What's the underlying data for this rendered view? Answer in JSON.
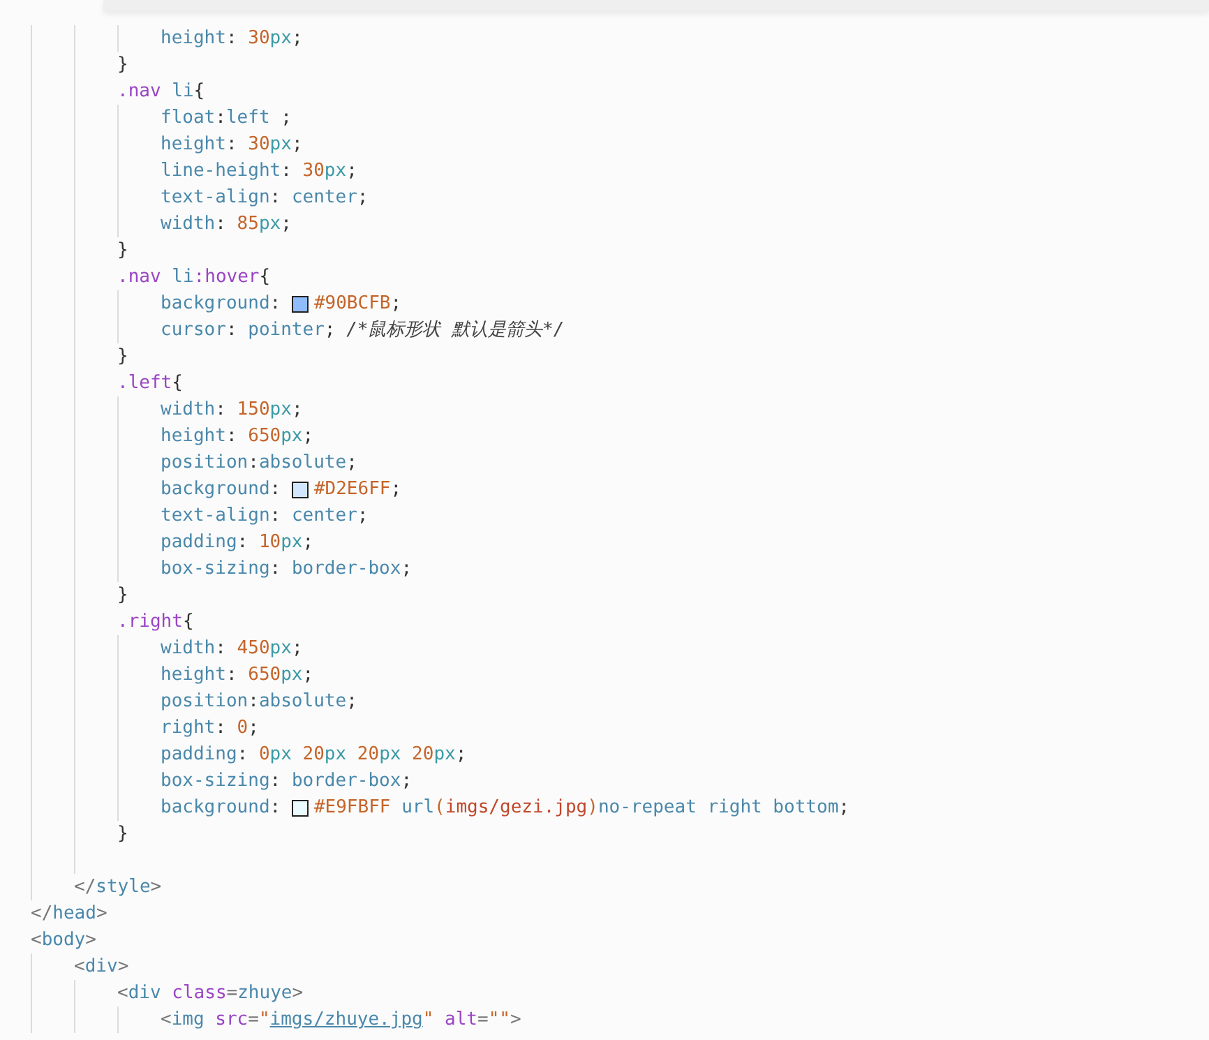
{
  "editor": {
    "lines": [
      {
        "kind": "wrap",
        "children": [
          {
            "kind": "wrap",
            "children": [
              {
                "kind": "wrap",
                "children": [
                  {
                    "kind": "code",
                    "tokens": [
                      {
                        "kind": "prop",
                        "text": "height"
                      },
                      {
                        "kind": "punct",
                        "text": ": "
                      },
                      {
                        "kind": "num",
                        "text": "30"
                      },
                      {
                        "kind": "unit",
                        "text": "px"
                      },
                      {
                        "kind": "punct",
                        "text": ";"
                      }
                    ]
                  }
                ]
              },
              {
                "kind": "code",
                "tokens": [
                  {
                    "kind": "punct",
                    "text": "}"
                  }
                ]
              },
              {
                "kind": "code",
                "tokens": [
                  {
                    "kind": "cls",
                    "text": ".nav "
                  },
                  {
                    "kind": "tagsel",
                    "text": "li"
                  },
                  {
                    "kind": "punct",
                    "text": "{"
                  }
                ],
                "children": [
                  {
                    "kind": "code",
                    "tokens": [
                      {
                        "kind": "prop",
                        "text": "float"
                      },
                      {
                        "kind": "punct",
                        "text": ":"
                      },
                      {
                        "kind": "kw",
                        "text": "left"
                      },
                      {
                        "kind": "punct",
                        "text": " ;"
                      }
                    ]
                  },
                  {
                    "kind": "code",
                    "tokens": [
                      {
                        "kind": "prop",
                        "text": "height"
                      },
                      {
                        "kind": "punct",
                        "text": ": "
                      },
                      {
                        "kind": "num",
                        "text": "30"
                      },
                      {
                        "kind": "unit",
                        "text": "px"
                      },
                      {
                        "kind": "punct",
                        "text": ";"
                      }
                    ]
                  },
                  {
                    "kind": "code",
                    "tokens": [
                      {
                        "kind": "prop",
                        "text": "line-height"
                      },
                      {
                        "kind": "punct",
                        "text": ": "
                      },
                      {
                        "kind": "num",
                        "text": "30"
                      },
                      {
                        "kind": "unit",
                        "text": "px"
                      },
                      {
                        "kind": "punct",
                        "text": ";"
                      }
                    ]
                  },
                  {
                    "kind": "code",
                    "tokens": [
                      {
                        "kind": "prop",
                        "text": "text-align"
                      },
                      {
                        "kind": "punct",
                        "text": ": "
                      },
                      {
                        "kind": "kw",
                        "text": "center"
                      },
                      {
                        "kind": "punct",
                        "text": ";"
                      }
                    ]
                  },
                  {
                    "kind": "code",
                    "tokens": [
                      {
                        "kind": "prop",
                        "text": "width"
                      },
                      {
                        "kind": "punct",
                        "text": ": "
                      },
                      {
                        "kind": "num",
                        "text": "85"
                      },
                      {
                        "kind": "unit",
                        "text": "px"
                      },
                      {
                        "kind": "punct",
                        "text": ";"
                      }
                    ]
                  }
                ]
              },
              {
                "kind": "code",
                "tokens": [
                  {
                    "kind": "punct",
                    "text": "}"
                  }
                ]
              },
              {
                "kind": "code",
                "tokens": [
                  {
                    "kind": "cls",
                    "text": ".nav "
                  },
                  {
                    "kind": "tagsel",
                    "text": "li"
                  },
                  {
                    "kind": "cls",
                    "text": ":hover"
                  },
                  {
                    "kind": "punct",
                    "text": "{"
                  }
                ],
                "children": [
                  {
                    "kind": "code",
                    "tokens": [
                      {
                        "kind": "prop",
                        "text": "background"
                      },
                      {
                        "kind": "punct",
                        "text": ": "
                      },
                      {
                        "kind": "swatch",
                        "color": "#90bcfb"
                      },
                      {
                        "kind": "num",
                        "text": "#90BCFB"
                      },
                      {
                        "kind": "punct",
                        "text": ";"
                      }
                    ]
                  },
                  {
                    "kind": "code",
                    "tokens": [
                      {
                        "kind": "prop",
                        "text": "cursor"
                      },
                      {
                        "kind": "punct",
                        "text": ": "
                      },
                      {
                        "kind": "kw",
                        "text": "pointer"
                      },
                      {
                        "kind": "punct",
                        "text": "; "
                      },
                      {
                        "kind": "comment",
                        "text": "/*鼠标形状 默认是箭头*/"
                      }
                    ]
                  }
                ]
              },
              {
                "kind": "code",
                "tokens": [
                  {
                    "kind": "punct",
                    "text": "}"
                  }
                ]
              },
              {
                "kind": "code",
                "tokens": [
                  {
                    "kind": "cls",
                    "text": ".left"
                  },
                  {
                    "kind": "punct",
                    "text": "{"
                  }
                ],
                "children": [
                  {
                    "kind": "code",
                    "tokens": [
                      {
                        "kind": "prop",
                        "text": "width"
                      },
                      {
                        "kind": "punct",
                        "text": ": "
                      },
                      {
                        "kind": "num",
                        "text": "150"
                      },
                      {
                        "kind": "unit",
                        "text": "px"
                      },
                      {
                        "kind": "punct",
                        "text": ";"
                      }
                    ]
                  },
                  {
                    "kind": "code",
                    "tokens": [
                      {
                        "kind": "prop",
                        "text": "height"
                      },
                      {
                        "kind": "punct",
                        "text": ": "
                      },
                      {
                        "kind": "num",
                        "text": "650"
                      },
                      {
                        "kind": "unit",
                        "text": "px"
                      },
                      {
                        "kind": "punct",
                        "text": ";"
                      }
                    ]
                  },
                  {
                    "kind": "code",
                    "tokens": [
                      {
                        "kind": "prop",
                        "text": "position"
                      },
                      {
                        "kind": "punct",
                        "text": ":"
                      },
                      {
                        "kind": "kw",
                        "text": "absolute"
                      },
                      {
                        "kind": "punct",
                        "text": ";"
                      }
                    ]
                  },
                  {
                    "kind": "code",
                    "tokens": [
                      {
                        "kind": "prop",
                        "text": "background"
                      },
                      {
                        "kind": "punct",
                        "text": ": "
                      },
                      {
                        "kind": "swatch",
                        "color": "#d2e6ff"
                      },
                      {
                        "kind": "num",
                        "text": "#D2E6FF"
                      },
                      {
                        "kind": "punct",
                        "text": ";"
                      }
                    ]
                  },
                  {
                    "kind": "code",
                    "tokens": [
                      {
                        "kind": "prop",
                        "text": "text-align"
                      },
                      {
                        "kind": "punct",
                        "text": ": "
                      },
                      {
                        "kind": "kw",
                        "text": "center"
                      },
                      {
                        "kind": "punct",
                        "text": ";"
                      }
                    ]
                  },
                  {
                    "kind": "code",
                    "tokens": [
                      {
                        "kind": "prop",
                        "text": "padding"
                      },
                      {
                        "kind": "punct",
                        "text": ": "
                      },
                      {
                        "kind": "num",
                        "text": "10"
                      },
                      {
                        "kind": "unit",
                        "text": "px"
                      },
                      {
                        "kind": "punct",
                        "text": ";"
                      }
                    ]
                  },
                  {
                    "kind": "code",
                    "tokens": [
                      {
                        "kind": "prop",
                        "text": "box-sizing"
                      },
                      {
                        "kind": "punct",
                        "text": ": "
                      },
                      {
                        "kind": "kw",
                        "text": "border-box"
                      },
                      {
                        "kind": "punct",
                        "text": ";"
                      }
                    ]
                  }
                ]
              },
              {
                "kind": "code",
                "tokens": [
                  {
                    "kind": "punct",
                    "text": "}"
                  }
                ]
              },
              {
                "kind": "code",
                "tokens": [
                  {
                    "kind": "cls",
                    "text": ".right"
                  },
                  {
                    "kind": "punct",
                    "text": "{"
                  }
                ],
                "children": [
                  {
                    "kind": "code",
                    "tokens": [
                      {
                        "kind": "prop",
                        "text": "width"
                      },
                      {
                        "kind": "punct",
                        "text": ": "
                      },
                      {
                        "kind": "num",
                        "text": "450"
                      },
                      {
                        "kind": "unit",
                        "text": "px"
                      },
                      {
                        "kind": "punct",
                        "text": ";"
                      }
                    ]
                  },
                  {
                    "kind": "code",
                    "tokens": [
                      {
                        "kind": "prop",
                        "text": "height"
                      },
                      {
                        "kind": "punct",
                        "text": ": "
                      },
                      {
                        "kind": "num",
                        "text": "650"
                      },
                      {
                        "kind": "unit",
                        "text": "px"
                      },
                      {
                        "kind": "punct",
                        "text": ";"
                      }
                    ]
                  },
                  {
                    "kind": "code",
                    "tokens": [
                      {
                        "kind": "prop",
                        "text": "position"
                      },
                      {
                        "kind": "punct",
                        "text": ":"
                      },
                      {
                        "kind": "kw",
                        "text": "absolute"
                      },
                      {
                        "kind": "punct",
                        "text": ";"
                      }
                    ]
                  },
                  {
                    "kind": "code",
                    "tokens": [
                      {
                        "kind": "prop",
                        "text": "right"
                      },
                      {
                        "kind": "punct",
                        "text": ": "
                      },
                      {
                        "kind": "num",
                        "text": "0"
                      },
                      {
                        "kind": "punct",
                        "text": ";"
                      }
                    ]
                  },
                  {
                    "kind": "code",
                    "tokens": [
                      {
                        "kind": "prop",
                        "text": "padding"
                      },
                      {
                        "kind": "punct",
                        "text": ": "
                      },
                      {
                        "kind": "num",
                        "text": "0"
                      },
                      {
                        "kind": "unit",
                        "text": "px "
                      },
                      {
                        "kind": "num",
                        "text": "20"
                      },
                      {
                        "kind": "unit",
                        "text": "px "
                      },
                      {
                        "kind": "num",
                        "text": "20"
                      },
                      {
                        "kind": "unit",
                        "text": "px "
                      },
                      {
                        "kind": "num",
                        "text": "20"
                      },
                      {
                        "kind": "unit",
                        "text": "px"
                      },
                      {
                        "kind": "punct",
                        "text": ";"
                      }
                    ]
                  },
                  {
                    "kind": "code",
                    "tokens": [
                      {
                        "kind": "prop",
                        "text": "box-sizing"
                      },
                      {
                        "kind": "punct",
                        "text": ": "
                      },
                      {
                        "kind": "kw",
                        "text": "border-box"
                      },
                      {
                        "kind": "punct",
                        "text": ";"
                      }
                    ]
                  },
                  {
                    "kind": "code",
                    "tokens": [
                      {
                        "kind": "prop",
                        "text": "background"
                      },
                      {
                        "kind": "punct",
                        "text": ": "
                      },
                      {
                        "kind": "swatch",
                        "color": "#e9fbff"
                      },
                      {
                        "kind": "num",
                        "text": "#E9FBFF "
                      },
                      {
                        "kind": "kw",
                        "text": "url"
                      },
                      {
                        "kind": "num",
                        "text": "("
                      },
                      {
                        "kind": "path",
                        "text": "imgs/gezi.jpg"
                      },
                      {
                        "kind": "num",
                        "text": ")"
                      },
                      {
                        "kind": "kw",
                        "text": "no-repeat right bottom"
                      },
                      {
                        "kind": "punct",
                        "text": ";"
                      }
                    ]
                  }
                ]
              },
              {
                "kind": "code",
                "tokens": [
                  {
                    "kind": "punct",
                    "text": "}"
                  }
                ]
              },
              {
                "kind": "blank"
              }
            ]
          },
          {
            "kind": "code",
            "tokens": [
              {
                "kind": "bracket",
                "text": "</"
              },
              {
                "kind": "tag",
                "text": "style"
              },
              {
                "kind": "bracket",
                "text": ">"
              }
            ]
          }
        ]
      },
      {
        "kind": "code",
        "tokens": [
          {
            "kind": "bracket",
            "text": "</"
          },
          {
            "kind": "tag",
            "text": "head"
          },
          {
            "kind": "bracket",
            "text": ">"
          }
        ]
      },
      {
        "kind": "code",
        "tokens": [
          {
            "kind": "bracket",
            "text": "<"
          },
          {
            "kind": "tag",
            "text": "body"
          },
          {
            "kind": "bracket",
            "text": ">"
          }
        ],
        "children": [
          {
            "kind": "code",
            "tokens": [
              {
                "kind": "bracket",
                "text": "<"
              },
              {
                "kind": "tag",
                "text": "div"
              },
              {
                "kind": "bracket",
                "text": ">"
              }
            ],
            "children": [
              {
                "kind": "code",
                "tokens": [
                  {
                    "kind": "bracket",
                    "text": "<"
                  },
                  {
                    "kind": "tag",
                    "text": "div "
                  },
                  {
                    "kind": "attr",
                    "text": "class"
                  },
                  {
                    "kind": "bracket",
                    "text": "="
                  },
                  {
                    "kind": "tag",
                    "text": "zhuye"
                  },
                  {
                    "kind": "bracket",
                    "text": ">"
                  }
                ],
                "children": [
                  {
                    "kind": "code",
                    "tokens": [
                      {
                        "kind": "bracket",
                        "text": "<"
                      },
                      {
                        "kind": "tag",
                        "text": "img "
                      },
                      {
                        "kind": "attr",
                        "text": "src"
                      },
                      {
                        "kind": "bracket",
                        "text": "="
                      },
                      {
                        "kind": "num",
                        "text": "\""
                      },
                      {
                        "kind": "link",
                        "text": "imgs/zhuye.jpg"
                      },
                      {
                        "kind": "num",
                        "text": "\" "
                      },
                      {
                        "kind": "attr",
                        "text": "alt"
                      },
                      {
                        "kind": "bracket",
                        "text": "="
                      },
                      {
                        "kind": "num",
                        "text": "\"\""
                      },
                      {
                        "kind": "bracket",
                        "text": ">"
                      }
                    ]
                  }
                ]
              }
            ]
          }
        ]
      }
    ]
  }
}
